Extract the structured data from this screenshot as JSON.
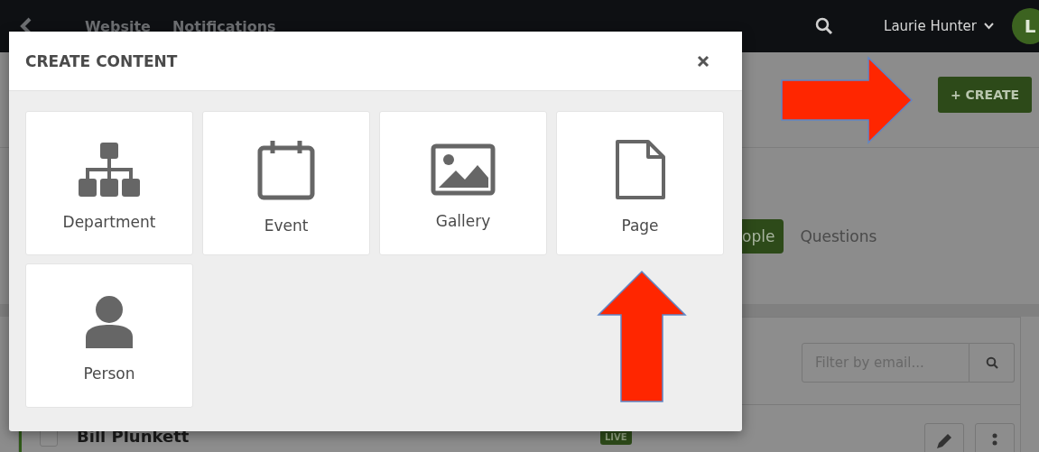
{
  "topbar": {
    "links": [
      "Website",
      "Notifications"
    ],
    "user": "Laurie Hunter",
    "avatar": "L"
  },
  "create_button": "+ CREATE",
  "tabs": [
    {
      "label": "ople",
      "selected": true
    },
    {
      "label": "Questions",
      "selected": false
    }
  ],
  "filter": {
    "placeholder": "Filter by email..."
  },
  "rows": [
    {
      "name": "Bill Plunkett",
      "checked": false,
      "status": "LIVE"
    }
  ],
  "modal": {
    "title": "CREATE CONTENT",
    "items": [
      {
        "label": "Department",
        "kind": "department"
      },
      {
        "label": "Event",
        "kind": "event"
      },
      {
        "label": "Gallery",
        "kind": "gallery"
      },
      {
        "label": "Page",
        "kind": "page"
      },
      {
        "label": "Person",
        "kind": "person"
      }
    ]
  }
}
